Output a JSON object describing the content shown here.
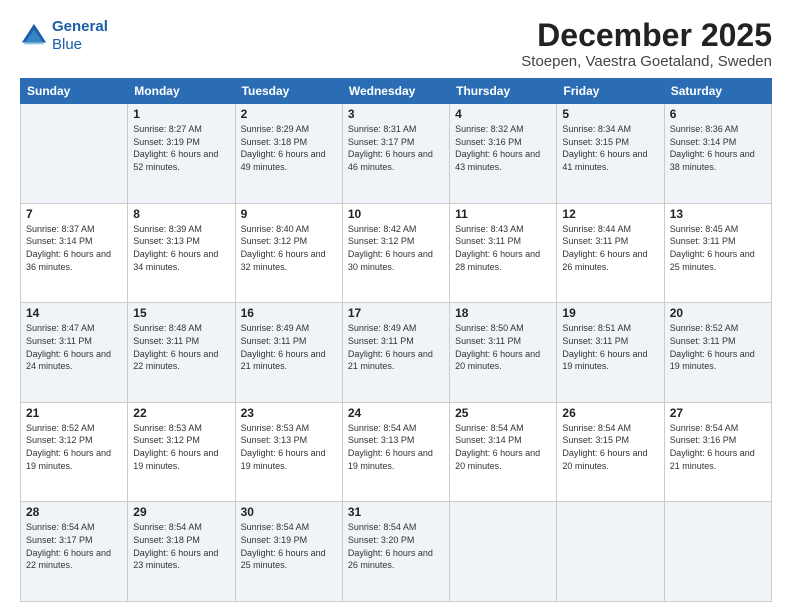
{
  "logo": {
    "line1": "General",
    "line2": "Blue"
  },
  "header": {
    "month": "December 2025",
    "location": "Stoepen, Vaestra Goetaland, Sweden"
  },
  "weekdays": [
    "Sunday",
    "Monday",
    "Tuesday",
    "Wednesday",
    "Thursday",
    "Friday",
    "Saturday"
  ],
  "weeks": [
    [
      {
        "day": "",
        "sunrise": "",
        "sunset": "",
        "daylight": ""
      },
      {
        "day": "1",
        "sunrise": "Sunrise: 8:27 AM",
        "sunset": "Sunset: 3:19 PM",
        "daylight": "Daylight: 6 hours and 52 minutes."
      },
      {
        "day": "2",
        "sunrise": "Sunrise: 8:29 AM",
        "sunset": "Sunset: 3:18 PM",
        "daylight": "Daylight: 6 hours and 49 minutes."
      },
      {
        "day": "3",
        "sunrise": "Sunrise: 8:31 AM",
        "sunset": "Sunset: 3:17 PM",
        "daylight": "Daylight: 6 hours and 46 minutes."
      },
      {
        "day": "4",
        "sunrise": "Sunrise: 8:32 AM",
        "sunset": "Sunset: 3:16 PM",
        "daylight": "Daylight: 6 hours and 43 minutes."
      },
      {
        "day": "5",
        "sunrise": "Sunrise: 8:34 AM",
        "sunset": "Sunset: 3:15 PM",
        "daylight": "Daylight: 6 hours and 41 minutes."
      },
      {
        "day": "6",
        "sunrise": "Sunrise: 8:36 AM",
        "sunset": "Sunset: 3:14 PM",
        "daylight": "Daylight: 6 hours and 38 minutes."
      }
    ],
    [
      {
        "day": "7",
        "sunrise": "Sunrise: 8:37 AM",
        "sunset": "Sunset: 3:14 PM",
        "daylight": "Daylight: 6 hours and 36 minutes."
      },
      {
        "day": "8",
        "sunrise": "Sunrise: 8:39 AM",
        "sunset": "Sunset: 3:13 PM",
        "daylight": "Daylight: 6 hours and 34 minutes."
      },
      {
        "day": "9",
        "sunrise": "Sunrise: 8:40 AM",
        "sunset": "Sunset: 3:12 PM",
        "daylight": "Daylight: 6 hours and 32 minutes."
      },
      {
        "day": "10",
        "sunrise": "Sunrise: 8:42 AM",
        "sunset": "Sunset: 3:12 PM",
        "daylight": "Daylight: 6 hours and 30 minutes."
      },
      {
        "day": "11",
        "sunrise": "Sunrise: 8:43 AM",
        "sunset": "Sunset: 3:11 PM",
        "daylight": "Daylight: 6 hours and 28 minutes."
      },
      {
        "day": "12",
        "sunrise": "Sunrise: 8:44 AM",
        "sunset": "Sunset: 3:11 PM",
        "daylight": "Daylight: 6 hours and 26 minutes."
      },
      {
        "day": "13",
        "sunrise": "Sunrise: 8:45 AM",
        "sunset": "Sunset: 3:11 PM",
        "daylight": "Daylight: 6 hours and 25 minutes."
      }
    ],
    [
      {
        "day": "14",
        "sunrise": "Sunrise: 8:47 AM",
        "sunset": "Sunset: 3:11 PM",
        "daylight": "Daylight: 6 hours and 24 minutes."
      },
      {
        "day": "15",
        "sunrise": "Sunrise: 8:48 AM",
        "sunset": "Sunset: 3:11 PM",
        "daylight": "Daylight: 6 hours and 22 minutes."
      },
      {
        "day": "16",
        "sunrise": "Sunrise: 8:49 AM",
        "sunset": "Sunset: 3:11 PM",
        "daylight": "Daylight: 6 hours and 21 minutes."
      },
      {
        "day": "17",
        "sunrise": "Sunrise: 8:49 AM",
        "sunset": "Sunset: 3:11 PM",
        "daylight": "Daylight: 6 hours and 21 minutes."
      },
      {
        "day": "18",
        "sunrise": "Sunrise: 8:50 AM",
        "sunset": "Sunset: 3:11 PM",
        "daylight": "Daylight: 6 hours and 20 minutes."
      },
      {
        "day": "19",
        "sunrise": "Sunrise: 8:51 AM",
        "sunset": "Sunset: 3:11 PM",
        "daylight": "Daylight: 6 hours and 19 minutes."
      },
      {
        "day": "20",
        "sunrise": "Sunrise: 8:52 AM",
        "sunset": "Sunset: 3:11 PM",
        "daylight": "Daylight: 6 hours and 19 minutes."
      }
    ],
    [
      {
        "day": "21",
        "sunrise": "Sunrise: 8:52 AM",
        "sunset": "Sunset: 3:12 PM",
        "daylight": "Daylight: 6 hours and 19 minutes."
      },
      {
        "day": "22",
        "sunrise": "Sunrise: 8:53 AM",
        "sunset": "Sunset: 3:12 PM",
        "daylight": "Daylight: 6 hours and 19 minutes."
      },
      {
        "day": "23",
        "sunrise": "Sunrise: 8:53 AM",
        "sunset": "Sunset: 3:13 PM",
        "daylight": "Daylight: 6 hours and 19 minutes."
      },
      {
        "day": "24",
        "sunrise": "Sunrise: 8:54 AM",
        "sunset": "Sunset: 3:13 PM",
        "daylight": "Daylight: 6 hours and 19 minutes."
      },
      {
        "day": "25",
        "sunrise": "Sunrise: 8:54 AM",
        "sunset": "Sunset: 3:14 PM",
        "daylight": "Daylight: 6 hours and 20 minutes."
      },
      {
        "day": "26",
        "sunrise": "Sunrise: 8:54 AM",
        "sunset": "Sunset: 3:15 PM",
        "daylight": "Daylight: 6 hours and 20 minutes."
      },
      {
        "day": "27",
        "sunrise": "Sunrise: 8:54 AM",
        "sunset": "Sunset: 3:16 PM",
        "daylight": "Daylight: 6 hours and 21 minutes."
      }
    ],
    [
      {
        "day": "28",
        "sunrise": "Sunrise: 8:54 AM",
        "sunset": "Sunset: 3:17 PM",
        "daylight": "Daylight: 6 hours and 22 minutes."
      },
      {
        "day": "29",
        "sunrise": "Sunrise: 8:54 AM",
        "sunset": "Sunset: 3:18 PM",
        "daylight": "Daylight: 6 hours and 23 minutes."
      },
      {
        "day": "30",
        "sunrise": "Sunrise: 8:54 AM",
        "sunset": "Sunset: 3:19 PM",
        "daylight": "Daylight: 6 hours and 25 minutes."
      },
      {
        "day": "31",
        "sunrise": "Sunrise: 8:54 AM",
        "sunset": "Sunset: 3:20 PM",
        "daylight": "Daylight: 6 hours and 26 minutes."
      },
      {
        "day": "",
        "sunrise": "",
        "sunset": "",
        "daylight": ""
      },
      {
        "day": "",
        "sunrise": "",
        "sunset": "",
        "daylight": ""
      },
      {
        "day": "",
        "sunrise": "",
        "sunset": "",
        "daylight": ""
      }
    ]
  ]
}
